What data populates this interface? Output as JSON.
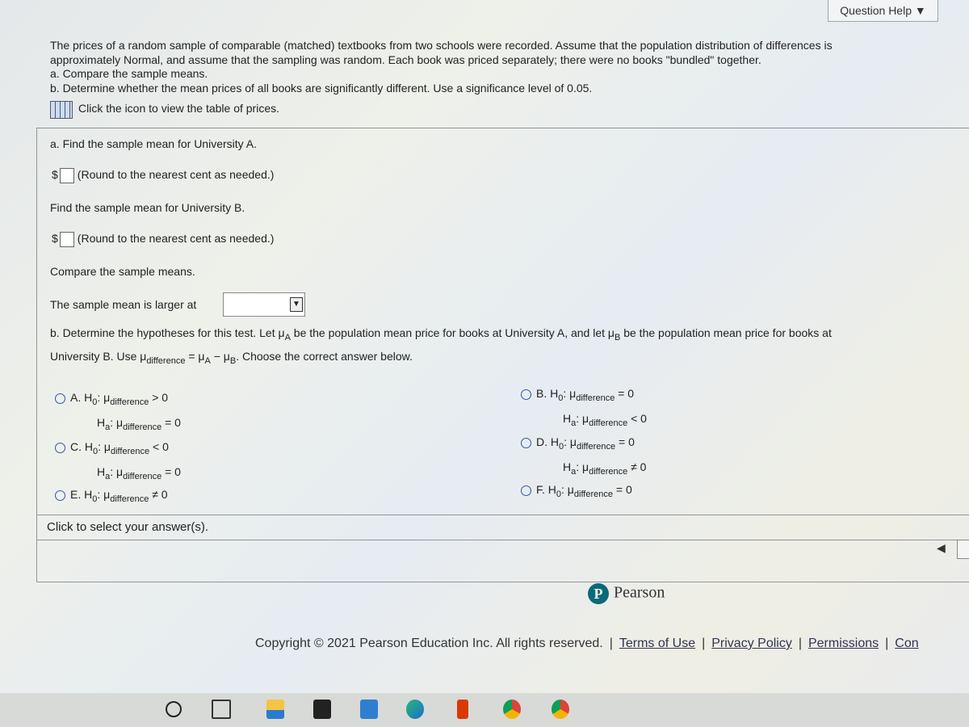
{
  "header": {
    "question_help": "Question Help ▼"
  },
  "problem": {
    "lines": [
      "The prices of a random sample of comparable (matched) textbooks from two schools were recorded. Assume that the population distribution of differences is",
      "approximately Normal, and assume that the sampling was random. Each book was priced separately; there were no books \"bundled\" together.",
      "a. Compare the sample means.",
      "b. Determine whether the mean prices of all books are significantly different. Use a significance level of 0.05."
    ],
    "table_link": "Click the icon to view the table of prices."
  },
  "part_a": {
    "q1": "a. Find the sample mean for University A.",
    "dollar": "$",
    "round_note": "(Round to the nearest cent as needed.)",
    "q2": "Find the sample mean for University B.",
    "q3": "Compare the sample means.",
    "q4": "The sample mean is larger at",
    "dropdown_value": ""
  },
  "part_b": {
    "line1_a": "b. Determine the hypotheses for this test. Let μ",
    "sub_a": "A",
    "line1_b": " be the population mean price for books at University A, and let μ",
    "sub_b": "B",
    "line1_c": " be the population mean price for books at",
    "line2_a": "University B. Use μ",
    "sub_diff": "difference",
    "line2_b": " = μ",
    "line2_c": " − μ",
    "line2_d": ". Choose the correct answer below."
  },
  "options": [
    {
      "label": "A.",
      "h0": "H",
      "h0_sub": "0",
      "mu": ": μ",
      "diff": "difference",
      "h0_rel": " > 0",
      "ha": "H",
      "ha_sub": "a",
      "ha_rel": " = 0"
    },
    {
      "label": "B.",
      "h0": "H",
      "h0_sub": "0",
      "mu": ": μ",
      "diff": "difference",
      "h0_rel": " = 0",
      "ha": "H",
      "ha_sub": "a",
      "ha_rel": " < 0"
    },
    {
      "label": "C.",
      "h0": "H",
      "h0_sub": "0",
      "mu": ": μ",
      "diff": "difference",
      "h0_rel": " < 0",
      "ha": "H",
      "ha_sub": "a",
      "ha_rel": " = 0"
    },
    {
      "label": "D.",
      "h0": "H",
      "h0_sub": "0",
      "mu": ": μ",
      "diff": "difference",
      "h0_rel": " = 0",
      "ha": "H",
      "ha_sub": "a",
      "ha_rel": " ≠ 0"
    },
    {
      "label": "E.",
      "h0": "H",
      "h0_sub": "0",
      "mu": ": μ",
      "diff": "difference",
      "h0_rel": " ≠ 0"
    },
    {
      "label": "F.",
      "h0": "H",
      "h0_sub": "0",
      "mu": ": μ",
      "diff": "difference",
      "h0_rel": " = 0"
    }
  ],
  "footer": {
    "select_hint": "Click to select your answer(s).",
    "brand": "Pearson",
    "brand_letter": "P",
    "copyright": "Copyright © 2021 Pearson Education Inc. All rights reserved.",
    "links": [
      "Terms of Use",
      "Privacy Policy",
      "Permissions",
      "Con"
    ]
  },
  "taskbar": {
    "icons": [
      "cortana-icon",
      "task-view-icon",
      "file-explorer-icon",
      "store-icon",
      "mail-icon",
      "edge-icon",
      "office-icon",
      "chrome-profile-icon",
      "chrome-icon"
    ]
  },
  "colors": {
    "accent": "#3355aa",
    "pearson": "#0b6a78"
  }
}
